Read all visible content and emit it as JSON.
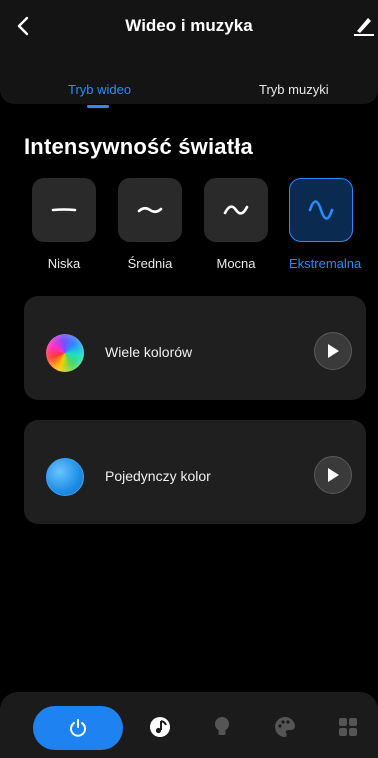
{
  "header": {
    "title": "Wideo i muzyka",
    "icons": {
      "back": "chevron-left-icon",
      "edit": "edit-icon"
    }
  },
  "tabs": [
    {
      "label": "Tryb wideo",
      "active": true
    },
    {
      "label": "Tryb muzyki",
      "active": false
    }
  ],
  "intensity": {
    "title": "Intensywność światła",
    "options": [
      {
        "label": "Niska",
        "icon": "flat-line-icon",
        "selected": false
      },
      {
        "label": "Średnia",
        "icon": "small-wave-icon",
        "selected": false
      },
      {
        "label": "Mocna",
        "icon": "wave-icon",
        "selected": false
      },
      {
        "label": "Ekstremalna",
        "icon": "large-wave-icon",
        "selected": true
      }
    ]
  },
  "cards": [
    {
      "label": "Wiele kolorów",
      "swatch": "multicolor-swatch",
      "action": "play-icon"
    },
    {
      "label": "Pojedynczy kolor",
      "swatch": "single-color-swatch",
      "action": "play-icon"
    }
  ],
  "bottom_nav": {
    "items": [
      "power-icon",
      "music-note-icon",
      "bulb-icon",
      "palette-icon",
      "grid-icon"
    ],
    "active": "power-icon"
  },
  "colors": {
    "accent": "#2a8bff",
    "background": "#000000",
    "card": "#1f1f1f"
  }
}
